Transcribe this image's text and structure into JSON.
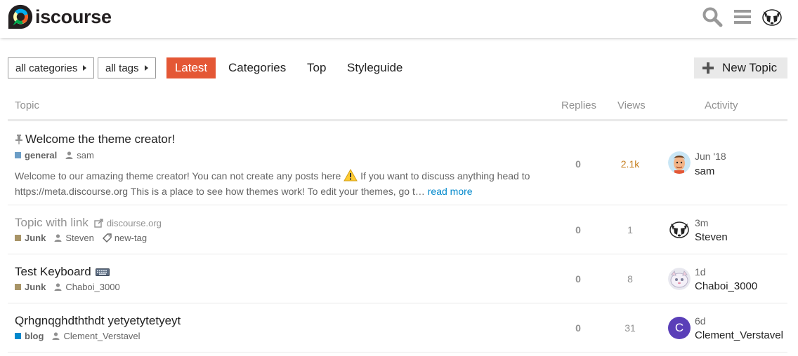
{
  "header": {
    "logo_text": "iscourse",
    "icons": [
      "search-icon",
      "hamburger-menu-icon",
      "user-avatar"
    ]
  },
  "nav": {
    "categories_dropdown": "all categories",
    "tags_dropdown": "all tags",
    "tabs": [
      "Latest",
      "Categories",
      "Top",
      "Styleguide"
    ],
    "active_tab": "Latest",
    "new_topic_label": "New Topic"
  },
  "table": {
    "headers": {
      "topic": "Topic",
      "replies": "Replies",
      "views": "Views",
      "activity": "Activity"
    },
    "rows": [
      {
        "title": "Welcome the theme creator!",
        "pinned": true,
        "category": "general",
        "category_color": "#6b9dc6",
        "poster": "sam",
        "excerpt": "Welcome to our amazing theme creator! You can not create any posts here ",
        "excerpt_2": " If you want to discuss anything head to https://meta.discourse.org This is a place to see how themes work! To edit your themes, go t…",
        "read_more": "read more",
        "replies": "0",
        "views": "2.1k",
        "activity_when": "Jun '18",
        "activity_user": "sam"
      },
      {
        "title": "Topic with link",
        "link_domain": "discourse.org",
        "category": "Junk",
        "category_color": "#a89467",
        "poster": "Steven",
        "tag": "new-tag",
        "replies": "0",
        "views": "1",
        "activity_when": "3m",
        "activity_user": "Steven"
      },
      {
        "title": "Test Keyboard",
        "category": "Junk",
        "category_color": "#a89467",
        "poster": "Chaboi_3000",
        "replies": "0",
        "views": "8",
        "activity_when": "1d",
        "activity_user": "Chaboi_3000"
      },
      {
        "title": "Qrhgnqghdththdt yetyetytetyeyt",
        "category": "blog",
        "category_color": "#0088cc",
        "poster": "Clement_Verstavel",
        "replies": "0",
        "views": "31",
        "activity_when": "6d",
        "activity_user": "Clement_Verstavel",
        "avatar_letter": "C",
        "avatar_color": "#5a3fb8"
      }
    ]
  },
  "colors": {
    "accent": "#e45735",
    "views_hot": "#c67e1e",
    "link": "#0088cc"
  }
}
